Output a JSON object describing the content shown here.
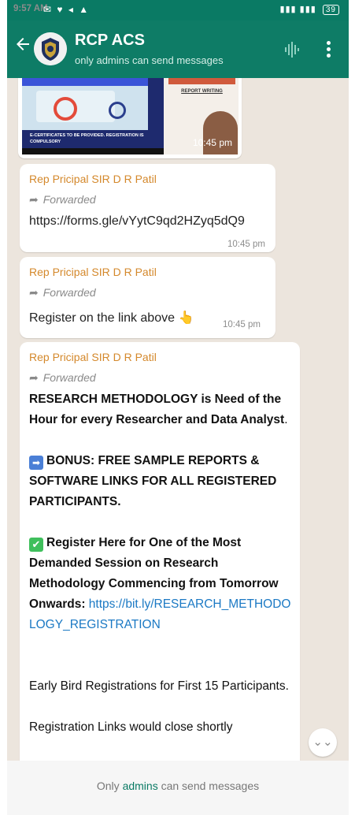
{
  "status_bar": {
    "time": "9:57 AM",
    "battery": "39"
  },
  "app_bar": {
    "title": "RCP ACS",
    "subtitle": "only admins can send messages"
  },
  "messages": [
    {
      "sender": "Rep Pricipal SIR D R Patil",
      "forwarded_label": "Forwarded",
      "link": "https://forms.gle/vYytC9qd2HZyq5dQ9",
      "time": "10:45 pm"
    },
    {
      "sender": "Rep Pricipal SIR D R Patil",
      "forwarded_label": "Forwarded",
      "text": "Register on the link above",
      "emoji": "👆",
      "time": "10:45 pm"
    },
    {
      "sender": "Rep Pricipal SIR D R Patil",
      "forwarded_label": "Forwarded",
      "para1_bold": "RESEARCH METHODOLOGY is Need of the Hour for every Researcher and Data Analyst",
      "para1_end": ".",
      "para2_bold": "BONUS: FREE SAMPLE REPORTS & SOFTWARE  LINKS FOR ALL REGISTERED PARTICIPANTS.",
      "para3_bold": "Register Here for One of the Most Demanded Session on Research Methodology Commencing from Tomorrow Onwards",
      "para3_colon": ": ",
      "para3_link": "https://bit.ly/RESEARCH_METHODOLOGY_REGISTRATION",
      "para4": "Early Bird Registrations for First 15 Participants.",
      "para5": "Registration Links would close shortly"
    }
  ],
  "image_message": {
    "time": "10:45 pm",
    "poster_text": "E-CERTIFICATES TO BE PROVIDED. REGISTRATION IS COMPULSORY",
    "poster_heading": "REPORT WRITING"
  },
  "footer": {
    "prefix": "Only ",
    "admins": "admins",
    "suffix": " can send messages"
  },
  "colors": {
    "header": "#0e7c66",
    "sender": "#d4882b",
    "link": "#1b79c4",
    "chat_bg": "#ece5dd"
  }
}
